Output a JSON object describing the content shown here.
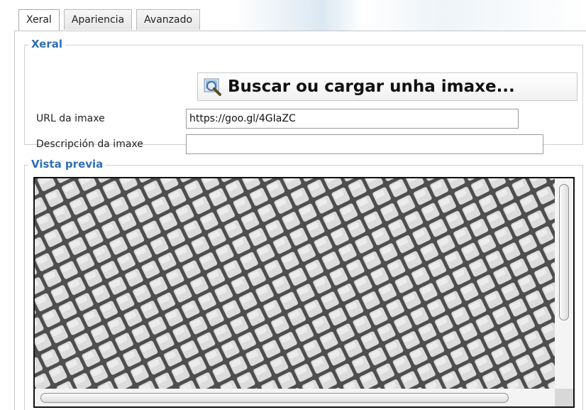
{
  "tabs": [
    {
      "label": "Xeral",
      "active": true
    },
    {
      "label": "Apariencia",
      "active": false
    },
    {
      "label": "Avanzado",
      "active": false
    }
  ],
  "general": {
    "legend": "Xeral",
    "browse_button": {
      "label": "Buscar ou cargar unha imaxe...",
      "icon": "magnifier-image-icon"
    },
    "url_label": "URL da imaxe",
    "url_value": "https://goo.gl/4GIaZC",
    "description_label": "Descripción da imaxe",
    "description_value": ""
  },
  "preview": {
    "legend": "Vista previa",
    "image": "cobblestone-pavement-image"
  },
  "colors": {
    "legend": "#2f6fb2",
    "cobble_light": "#e3e3e3",
    "cobble_grout": "#4a4a4a"
  }
}
